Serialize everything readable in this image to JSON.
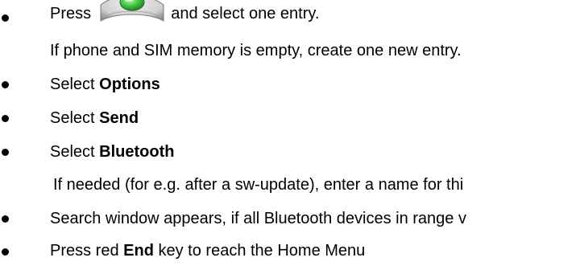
{
  "items": [
    {
      "pre": "Press",
      "post": "and select one entry.",
      "note": "If phone and SIM memory is empty, create one new entry."
    },
    {
      "pre": "Select ",
      "bold": "Options"
    },
    {
      "pre": "Select ",
      "bold": "Send"
    },
    {
      "pre": "Select ",
      "bold": "Bluetooth",
      "note": "If needed (for e.g. after a sw-update), enter a name for thi"
    },
    {
      "pre": "Search window appears, if all Bluetooth devices in range v"
    },
    {
      "pre": "Press red ",
      "bold": "End",
      "post": " key to reach the Home Menu"
    }
  ],
  "icons": {
    "navi_key": "navi-key-icon",
    "key_colors": {
      "center": "#3ec43e",
      "rim": "#d9d9d9",
      "edge": "#8c8c8c"
    }
  }
}
